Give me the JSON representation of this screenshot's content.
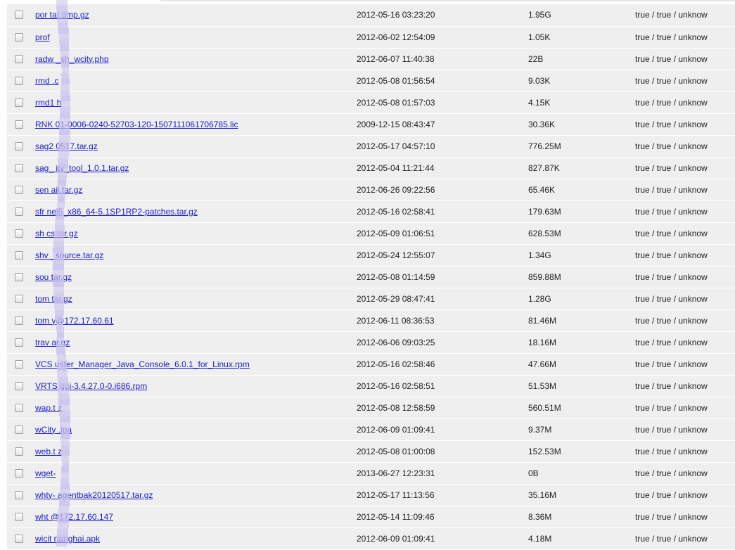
{
  "file_list": {
    "rows": [
      {
        "name": "por    tat.dmp.gz",
        "date": "2012-05-16 03:23:20",
        "size": "1.95G",
        "perms": "true / true / unknow"
      },
      {
        "name": "prof",
        "date": "2012-06-02 12:54:09",
        "size": "1.05K",
        "perms": "true / true / unknow"
      },
      {
        "name": "radw    _sh_wcity.php",
        "date": "2012-06-07 11:40:38",
        "size": "22B",
        "perms": "true / true / unknow"
      },
      {
        "name": "rmd    .c",
        "date": "2012-05-08 01:56:54",
        "size": "9.03K",
        "perms": "true / true / unknow"
      },
      {
        "name": "rmd1    h",
        "date": "2012-05-08 01:57:03",
        "size": "4.15K",
        "perms": "true / true / unknow"
      },
      {
        "name": "RNK    01-0006-0240-52703-120-1507111061706785.lic",
        "date": "2009-12-15 08:43:47",
        "size": "30.36K",
        "perms": "true / true / unknow"
      },
      {
        "name": "sag2    0517.tar.gz",
        "date": "2012-05-17 04:57:10",
        "size": "776.25M",
        "perms": "true / true / unknow"
      },
      {
        "name": "sag_    ity_tool_1.0.1.tar.gz",
        "date": "2012-05-04 11:21:44",
        "size": "827.87K",
        "perms": "true / true / unknow"
      },
      {
        "name": "sen    ail.tar.gz",
        "date": "2012-06-26 09:22:56",
        "size": "65.46K",
        "perms": "true / true / unknow"
      },
      {
        "name": "sfr    nel5_x86_64-5.1SP1RP2-patches.tar.gz",
        "date": "2012-05-16 02:58:41",
        "size": "179.63M",
        "perms": "true / true / unknow"
      },
      {
        "name": "sh    cs.tar.gz",
        "date": "2012-05-09 01:06:51",
        "size": "628.53M",
        "perms": "true / true / unknow"
      },
      {
        "name": "shv    _source.tar.gz",
        "date": "2012-05-24 12:55:07",
        "size": "1.34G",
        "perms": "true / true / unknow"
      },
      {
        "name": "sou    tar.gz",
        "date": "2012-05-08 01:14:59",
        "size": "859.88M",
        "perms": "true / true / unknow"
      },
      {
        "name": "tom    tar.gz",
        "date": "2012-05-29 08:47:41",
        "size": "1.28G",
        "perms": "true / true / unknow"
      },
      {
        "name": "tom    y@172.17.60.61",
        "date": "2012-06-11 08:36:53",
        "size": "81.46M",
        "perms": "true / true / unknow"
      },
      {
        "name": "trav    ar.gz",
        "date": "2012-06-06 09:03:25",
        "size": "18.16M",
        "perms": "true / true / unknow"
      },
      {
        "name": "VCS    uster_Manager_Java_Console_6.0.1_for_Linux.rpm",
        "date": "2012-05-16 02:58:46",
        "size": "47.66M",
        "perms": "true / true / unknow"
      },
      {
        "name": "VRTS    gui-3.4.27.0-0.i686.rpm",
        "date": "2012-05-16 02:58:51",
        "size": "51.53M",
        "perms": "true / true / unknow"
      },
      {
        "name": "wap.t    z",
        "date": "2012-05-08 12:58:59",
        "size": "560.51M",
        "perms": "true / true / unknow"
      },
      {
        "name": "wCity    .ipa",
        "date": "2012-06-09 01:09:41",
        "size": "9.37M",
        "perms": "true / true / unknow"
      },
      {
        "name": "web.t    z",
        "date": "2012-05-08 01:00:08",
        "size": "152.53M",
        "perms": "true / true / unknow"
      },
      {
        "name": "wget-",
        "date": "2013-06-27 12:23:31",
        "size": "0B",
        "perms": "true / true / unknow"
      },
      {
        "name": "whty-    agentbak20120517.tar.gz",
        "date": "2012-05-17 11:13:56",
        "size": "35.16M",
        "perms": "true / true / unknow"
      },
      {
        "name": "wht    @172.17.60.147",
        "date": "2012-05-14 11:09:46",
        "size": "8.36M",
        "perms": "true / true / unknow"
      },
      {
        "name": "wicit    nanghai.apk",
        "date": "2012-06-09 01:09:41",
        "size": "4.18M",
        "perms": "true / true / unknow"
      }
    ]
  },
  "colors": {
    "row_bg": "#efefef",
    "link": "#1a1acc",
    "redaction": "#c8c0ee"
  },
  "icons": {
    "row_select": "checkbox"
  }
}
